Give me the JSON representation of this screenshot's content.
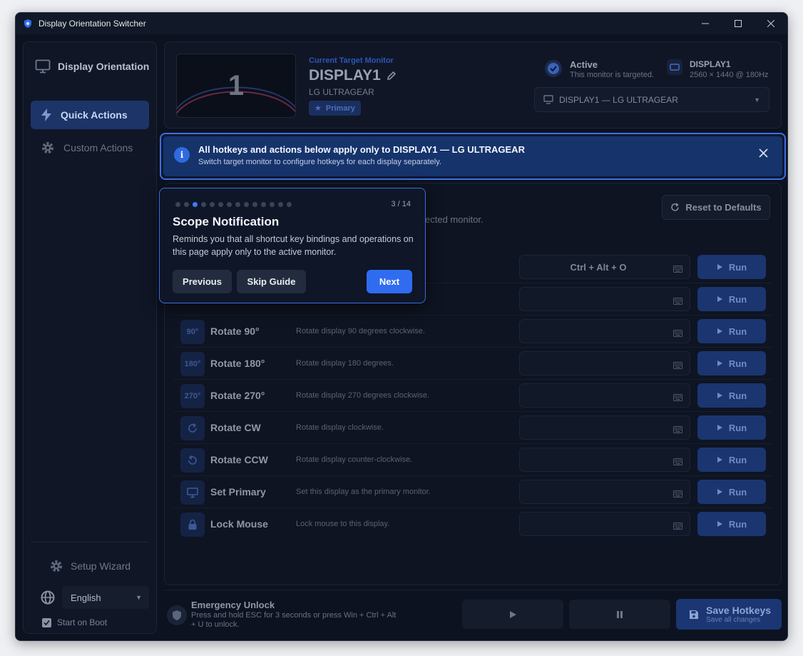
{
  "window": {
    "title": "Display Orientation Switcher"
  },
  "colors": {
    "accent": "#2f6cf0",
    "background": "#0c1220",
    "banner": "#16336b"
  },
  "sidebar": {
    "brand": "Display Orientation",
    "items": [
      {
        "label": "Quick Actions",
        "icon": "lightning-icon",
        "active": true
      },
      {
        "label": "Custom Actions",
        "icon": "gear-icon",
        "active": false
      }
    ],
    "setup_wizard": "Setup Wizard",
    "language": "English",
    "start_on_boot": "Start on Boot"
  },
  "target": {
    "label": "Current Target Monitor",
    "name": "DISPLAY1",
    "model": "LG ULTRAGEAR",
    "badge": "Primary",
    "preview_number": "1",
    "status_title": "Active",
    "status_sub": "This monitor is targeted.",
    "display_title": "DISPLAY1",
    "display_sub": "2560 × 1440 @ 180Hz",
    "select_value": "DISPLAY1 — LG ULTRAGEAR"
  },
  "banner": {
    "title": "All hotkeys and actions below apply only to DISPLAY1 — LG ULTRAGEAR",
    "sub": "Switch target monitor to configure hotkeys for each display separately."
  },
  "hotkeys": {
    "subtitle_peek": "ected monitor.",
    "reset_label": "Reset to Defaults",
    "run_label": "Run",
    "rows": [
      {
        "icon": "",
        "name": "",
        "desc": "",
        "key": "Ctrl + Alt + O"
      },
      {
        "icon": "",
        "name": "",
        "desc": "",
        "key": ""
      },
      {
        "icon": "90°",
        "name": "Rotate 90°",
        "desc": "Rotate display 90 degrees clockwise.",
        "key": ""
      },
      {
        "icon": "180°",
        "name": "Rotate 180°",
        "desc": "Rotate display 180 degrees.",
        "key": ""
      },
      {
        "icon": "270°",
        "name": "Rotate 270°",
        "desc": "Rotate display 270 degrees clockwise.",
        "key": ""
      },
      {
        "icon": "",
        "name": "Rotate CW",
        "desc": "Rotate display clockwise.",
        "key": ""
      },
      {
        "icon": "",
        "name": "Rotate CCW",
        "desc": "Rotate display counter-clockwise.",
        "key": ""
      },
      {
        "icon": "",
        "name": "Set Primary",
        "desc": "Set this display as the primary monitor.",
        "key": ""
      },
      {
        "icon": "",
        "name": "Lock Mouse",
        "desc": "Lock mouse to this display.",
        "key": ""
      }
    ]
  },
  "bottom": {
    "emergency_title": "Emergency Unlock",
    "emergency_sub": "Press and hold ESC for 3 seconds or press Win + Ctrl + Alt + U to unlock.",
    "save_title": "Save Hotkeys",
    "save_sub": "Save all changes"
  },
  "guide": {
    "step": "3 / 14",
    "current_step": 3,
    "total_steps": 14,
    "title": "Scope Notification",
    "body": "Reminds you that all shortcut key bindings and operations on this page apply only to the active monitor.",
    "previous": "Previous",
    "skip": "Skip Guide",
    "next": "Next"
  }
}
